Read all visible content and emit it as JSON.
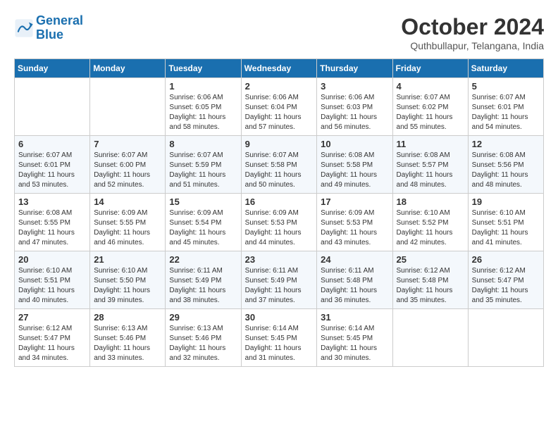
{
  "header": {
    "logo_line1": "General",
    "logo_line2": "Blue",
    "month": "October 2024",
    "location": "Quthbullapur, Telangana, India"
  },
  "weekdays": [
    "Sunday",
    "Monday",
    "Tuesday",
    "Wednesday",
    "Thursday",
    "Friday",
    "Saturday"
  ],
  "weeks": [
    [
      {
        "day": "",
        "sunrise": "",
        "sunset": "",
        "daylight": ""
      },
      {
        "day": "",
        "sunrise": "",
        "sunset": "",
        "daylight": ""
      },
      {
        "day": "1",
        "sunrise": "Sunrise: 6:06 AM",
        "sunset": "Sunset: 6:05 PM",
        "daylight": "Daylight: 11 hours and 58 minutes."
      },
      {
        "day": "2",
        "sunrise": "Sunrise: 6:06 AM",
        "sunset": "Sunset: 6:04 PM",
        "daylight": "Daylight: 11 hours and 57 minutes."
      },
      {
        "day": "3",
        "sunrise": "Sunrise: 6:06 AM",
        "sunset": "Sunset: 6:03 PM",
        "daylight": "Daylight: 11 hours and 56 minutes."
      },
      {
        "day": "4",
        "sunrise": "Sunrise: 6:07 AM",
        "sunset": "Sunset: 6:02 PM",
        "daylight": "Daylight: 11 hours and 55 minutes."
      },
      {
        "day": "5",
        "sunrise": "Sunrise: 6:07 AM",
        "sunset": "Sunset: 6:01 PM",
        "daylight": "Daylight: 11 hours and 54 minutes."
      }
    ],
    [
      {
        "day": "6",
        "sunrise": "Sunrise: 6:07 AM",
        "sunset": "Sunset: 6:01 PM",
        "daylight": "Daylight: 11 hours and 53 minutes."
      },
      {
        "day": "7",
        "sunrise": "Sunrise: 6:07 AM",
        "sunset": "Sunset: 6:00 PM",
        "daylight": "Daylight: 11 hours and 52 minutes."
      },
      {
        "day": "8",
        "sunrise": "Sunrise: 6:07 AM",
        "sunset": "Sunset: 5:59 PM",
        "daylight": "Daylight: 11 hours and 51 minutes."
      },
      {
        "day": "9",
        "sunrise": "Sunrise: 6:07 AM",
        "sunset": "Sunset: 5:58 PM",
        "daylight": "Daylight: 11 hours and 50 minutes."
      },
      {
        "day": "10",
        "sunrise": "Sunrise: 6:08 AM",
        "sunset": "Sunset: 5:58 PM",
        "daylight": "Daylight: 11 hours and 49 minutes."
      },
      {
        "day": "11",
        "sunrise": "Sunrise: 6:08 AM",
        "sunset": "Sunset: 5:57 PM",
        "daylight": "Daylight: 11 hours and 48 minutes."
      },
      {
        "day": "12",
        "sunrise": "Sunrise: 6:08 AM",
        "sunset": "Sunset: 5:56 PM",
        "daylight": "Daylight: 11 hours and 48 minutes."
      }
    ],
    [
      {
        "day": "13",
        "sunrise": "Sunrise: 6:08 AM",
        "sunset": "Sunset: 5:55 PM",
        "daylight": "Daylight: 11 hours and 47 minutes."
      },
      {
        "day": "14",
        "sunrise": "Sunrise: 6:09 AM",
        "sunset": "Sunset: 5:55 PM",
        "daylight": "Daylight: 11 hours and 46 minutes."
      },
      {
        "day": "15",
        "sunrise": "Sunrise: 6:09 AM",
        "sunset": "Sunset: 5:54 PM",
        "daylight": "Daylight: 11 hours and 45 minutes."
      },
      {
        "day": "16",
        "sunrise": "Sunrise: 6:09 AM",
        "sunset": "Sunset: 5:53 PM",
        "daylight": "Daylight: 11 hours and 44 minutes."
      },
      {
        "day": "17",
        "sunrise": "Sunrise: 6:09 AM",
        "sunset": "Sunset: 5:53 PM",
        "daylight": "Daylight: 11 hours and 43 minutes."
      },
      {
        "day": "18",
        "sunrise": "Sunrise: 6:10 AM",
        "sunset": "Sunset: 5:52 PM",
        "daylight": "Daylight: 11 hours and 42 minutes."
      },
      {
        "day": "19",
        "sunrise": "Sunrise: 6:10 AM",
        "sunset": "Sunset: 5:51 PM",
        "daylight": "Daylight: 11 hours and 41 minutes."
      }
    ],
    [
      {
        "day": "20",
        "sunrise": "Sunrise: 6:10 AM",
        "sunset": "Sunset: 5:51 PM",
        "daylight": "Daylight: 11 hours and 40 minutes."
      },
      {
        "day": "21",
        "sunrise": "Sunrise: 6:10 AM",
        "sunset": "Sunset: 5:50 PM",
        "daylight": "Daylight: 11 hours and 39 minutes."
      },
      {
        "day": "22",
        "sunrise": "Sunrise: 6:11 AM",
        "sunset": "Sunset: 5:49 PM",
        "daylight": "Daylight: 11 hours and 38 minutes."
      },
      {
        "day": "23",
        "sunrise": "Sunrise: 6:11 AM",
        "sunset": "Sunset: 5:49 PM",
        "daylight": "Daylight: 11 hours and 37 minutes."
      },
      {
        "day": "24",
        "sunrise": "Sunrise: 6:11 AM",
        "sunset": "Sunset: 5:48 PM",
        "daylight": "Daylight: 11 hours and 36 minutes."
      },
      {
        "day": "25",
        "sunrise": "Sunrise: 6:12 AM",
        "sunset": "Sunset: 5:48 PM",
        "daylight": "Daylight: 11 hours and 35 minutes."
      },
      {
        "day": "26",
        "sunrise": "Sunrise: 6:12 AM",
        "sunset": "Sunset: 5:47 PM",
        "daylight": "Daylight: 11 hours and 35 minutes."
      }
    ],
    [
      {
        "day": "27",
        "sunrise": "Sunrise: 6:12 AM",
        "sunset": "Sunset: 5:47 PM",
        "daylight": "Daylight: 11 hours and 34 minutes."
      },
      {
        "day": "28",
        "sunrise": "Sunrise: 6:13 AM",
        "sunset": "Sunset: 5:46 PM",
        "daylight": "Daylight: 11 hours and 33 minutes."
      },
      {
        "day": "29",
        "sunrise": "Sunrise: 6:13 AM",
        "sunset": "Sunset: 5:46 PM",
        "daylight": "Daylight: 11 hours and 32 minutes."
      },
      {
        "day": "30",
        "sunrise": "Sunrise: 6:14 AM",
        "sunset": "Sunset: 5:45 PM",
        "daylight": "Daylight: 11 hours and 31 minutes."
      },
      {
        "day": "31",
        "sunrise": "Sunrise: 6:14 AM",
        "sunset": "Sunset: 5:45 PM",
        "daylight": "Daylight: 11 hours and 30 minutes."
      },
      {
        "day": "",
        "sunrise": "",
        "sunset": "",
        "daylight": ""
      },
      {
        "day": "",
        "sunrise": "",
        "sunset": "",
        "daylight": ""
      }
    ]
  ]
}
